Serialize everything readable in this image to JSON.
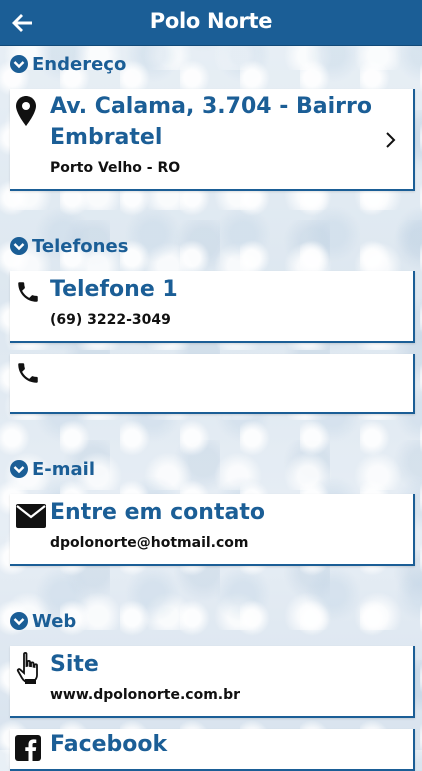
{
  "header": {
    "title": "Polo Norte",
    "back_icon": "arrow-left-icon"
  },
  "address": {
    "section_label": "Endereço",
    "line1": "Av. Calama, 3.704 - Bairro",
    "line2": "Embratel",
    "city": "Porto Velho - RO",
    "icon": "location-pin-icon"
  },
  "phones": {
    "section_label": "Telefones",
    "items": [
      {
        "title": "Telefone 1",
        "number": "(69) 3222-3049"
      },
      {
        "title": "",
        "number": ""
      }
    ]
  },
  "email": {
    "section_label": "E-mail",
    "title": "Entre em contato",
    "value": "dpolonorte@hotmail.com"
  },
  "web": {
    "section_label": "Web",
    "site": {
      "title": "Site",
      "value": "www.dpolonorte.com.br"
    },
    "facebook": {
      "title": "Facebook"
    }
  },
  "colors": {
    "accent": "#1b5e96",
    "card": "#ffffff"
  }
}
